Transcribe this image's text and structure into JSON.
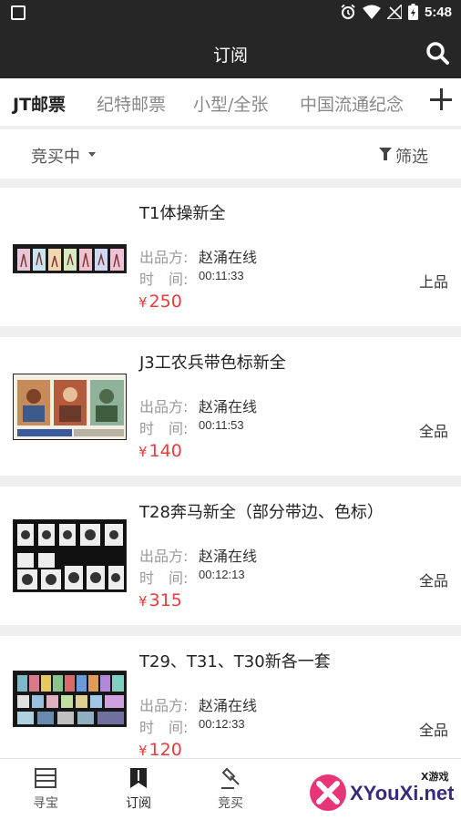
{
  "status_bar": {
    "time": "5:48"
  },
  "header": {
    "title": "订阅"
  },
  "tabs": [
    {
      "label": "JT邮票",
      "active": true
    },
    {
      "label": "纪特邮票",
      "active": false
    },
    {
      "label": "小型/全张",
      "active": false
    },
    {
      "label": "中国流通纪念",
      "active": false
    }
  ],
  "filter": {
    "sort_label": "竞买中",
    "filter_label": "筛选"
  },
  "labels": {
    "seller": "出品方:",
    "time": "时　间:",
    "currency": "¥"
  },
  "items": [
    {
      "name": "T1体操新全",
      "seller": "赵涌在线",
      "time": "00:11:33",
      "price": "250",
      "condition": "上品"
    },
    {
      "name": "J3工农兵带色标新全",
      "seller": "赵涌在线",
      "time": "00:11:53",
      "price": "140",
      "condition": "全品"
    },
    {
      "name": "T28奔马新全（部分带边、色标）",
      "seller": "赵涌在线",
      "time": "00:12:13",
      "price": "315",
      "condition": "全品"
    },
    {
      "name": "T29、T31、T30新各一套",
      "seller": "赵涌在线",
      "time": "00:12:33",
      "price": "120",
      "condition": "全品"
    }
  ],
  "bottom_nav": [
    {
      "label": "寻宝",
      "icon": "treasure-icon"
    },
    {
      "label": "订阅",
      "icon": "bookmark-icon",
      "active": true
    },
    {
      "label": "竞买",
      "icon": "gavel-icon"
    }
  ],
  "watermark": {
    "text": "XYouXi.net",
    "small": "X游戏"
  },
  "colors": {
    "header_bg": "#262626",
    "price": "#e83c3c"
  }
}
